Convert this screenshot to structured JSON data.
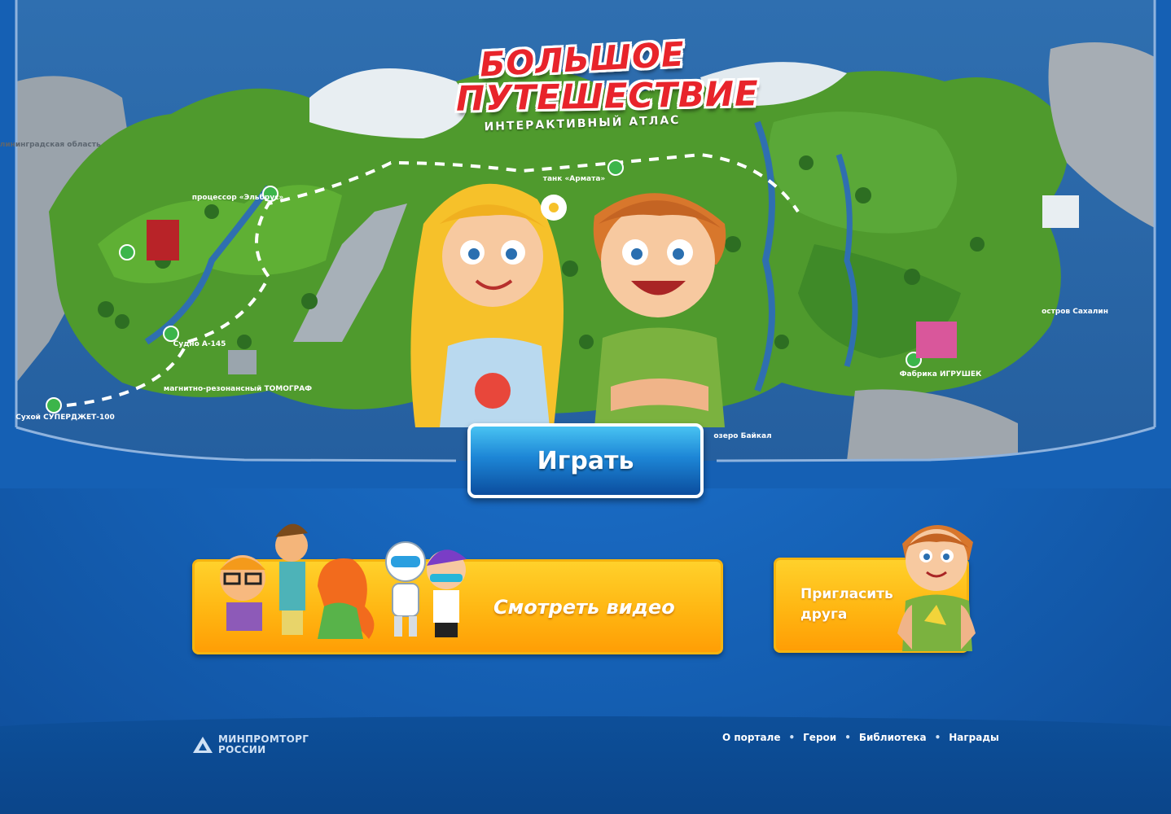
{
  "logo": {
    "line1": "БОЛЬШОЕ",
    "line2": "ПУТЕШЕСТВИЕ",
    "subtitle": "ИНТЕРАКТИВНЫЙ АТЛАС"
  },
  "map_labels": [
    {
      "id": "elbrus",
      "text": "процессор «Эльбрус»"
    },
    {
      "id": "armata",
      "text": "танк «Армата»"
    },
    {
      "id": "sudno",
      "text": "Судно А-145"
    },
    {
      "id": "tomograf",
      "text": "магнитно-резонансный ТОМОГРАФ"
    },
    {
      "id": "superjet",
      "text": "Сухой СУПЕРДЖЕТ-100"
    },
    {
      "id": "toys",
      "text": "Фабрика ИГРУШЕК"
    },
    {
      "id": "baikal",
      "text": "озеро Байкал"
    },
    {
      "id": "sakhalin",
      "text": "остров Сахалин"
    },
    {
      "id": "region",
      "text": "Калининградская область"
    }
  ],
  "buttons": {
    "play": "Играть",
    "watch_video": "Смотреть видео",
    "invite_friend": "Пригласить друга"
  },
  "footer": {
    "ministry_line1": "МИНПРОМТОРГ",
    "ministry_line2": "РОССИИ",
    "nav": [
      "О портале",
      "Герои",
      "Библиотека",
      "Награды"
    ]
  },
  "colors": {
    "page_blue": "#1762b8",
    "play_button": "#1d86d6",
    "card_yellow": "#ffb612",
    "logo_red": "#e8242b"
  }
}
